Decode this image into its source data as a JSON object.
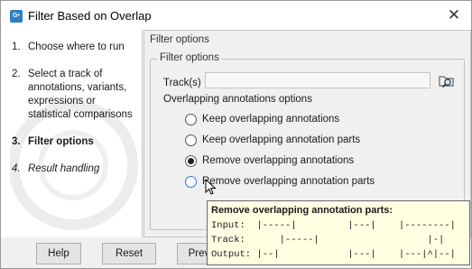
{
  "window": {
    "title": "Filter Based on Overlap",
    "app_icon_label": "G•"
  },
  "steps": [
    {
      "number": "1.",
      "label": "Choose where to run",
      "state": "done"
    },
    {
      "number": "2.",
      "label": "Select a track of annotations, variants, expressions or statistical comparisons",
      "state": "done"
    },
    {
      "number": "3.",
      "label": "Filter options",
      "state": "current"
    },
    {
      "number": "4.",
      "label": "Result handling",
      "state": "future"
    }
  ],
  "main": {
    "header": "Filter options",
    "group_title": "Filter options",
    "track_label": "Track(s)",
    "track_value": "",
    "overlap_section_label": "Overlapping annotations options",
    "options": [
      {
        "label": "Keep overlapping annotations",
        "checked": false
      },
      {
        "label": "Keep overlapping annotation parts",
        "checked": false
      },
      {
        "label": "Remove overlapping annotations",
        "checked": true
      },
      {
        "label": "Remove overlapping annotation parts",
        "checked": false
      }
    ]
  },
  "buttons": {
    "help": "Help",
    "reset": "Reset",
    "previous": "Previous"
  },
  "tooltip": {
    "title": "Remove overlapping annotation parts:",
    "lines": [
      "Input:  |-----|         |---|    |--------|",
      "Track:      |-----|                   |-|",
      "Output: |--|            |---|    |---|^|--|"
    ]
  },
  "colors": {
    "accent": "#2e7fc1",
    "tooltip_bg": "#ffffe1",
    "panel_bg": "#f0f0f0"
  }
}
